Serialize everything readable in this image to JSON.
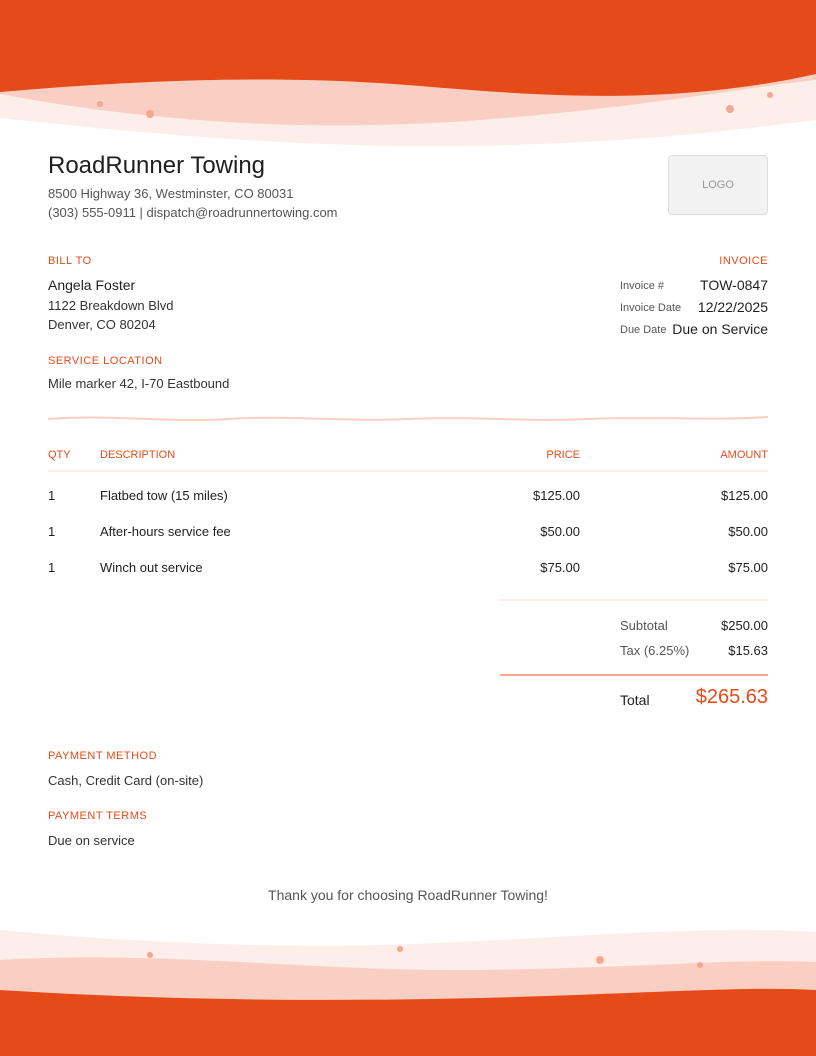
{
  "colors": {
    "accent": "#e64a19",
    "wave_light": "#f8cfc2",
    "wave_pale": "#fdeeea"
  },
  "company": {
    "name": "RoadRunner Towing",
    "address": "8500 Highway 36, Westminster, CO 80031",
    "contact": "(303) 555-0911 | dispatch@roadrunnertowing.com",
    "logo_text": "LOGO"
  },
  "bill_to": {
    "label": "BILL TO",
    "name": "Angela Foster",
    "street": "1122 Breakdown Blvd",
    "city": "Denver, CO 80204"
  },
  "service_location": {
    "label": "SERVICE LOCATION",
    "value": "Mile marker 42, I-70 Eastbound"
  },
  "invoice": {
    "label": "INVOICE",
    "number_label": "Invoice #",
    "number": "TOW-0847",
    "date_label": "Invoice Date",
    "date": "12/22/2025",
    "due_label": "Due Date",
    "due": "Due on Service"
  },
  "table": {
    "headers": {
      "qty": "QTY",
      "description": "DESCRIPTION",
      "price": "PRICE",
      "amount": "AMOUNT"
    },
    "rows": [
      {
        "qty": "1",
        "description": "Flatbed tow (15 miles)",
        "price": "$125.00",
        "amount": "$125.00"
      },
      {
        "qty": "1",
        "description": "After-hours service fee",
        "price": "$50.00",
        "amount": "$50.00"
      },
      {
        "qty": "1",
        "description": "Winch out service",
        "price": "$75.00",
        "amount": "$75.00"
      }
    ]
  },
  "totals": {
    "subtotal_label": "Subtotal",
    "subtotal": "$250.00",
    "tax_label": "Tax (6.25%)",
    "tax": "$15.63",
    "total_label": "Total",
    "total": "$265.63"
  },
  "payment": {
    "method_label": "PAYMENT METHOD",
    "method": "Cash, Credit Card (on-site)",
    "terms_label": "PAYMENT TERMS",
    "terms": "Due on service"
  },
  "footer": {
    "thanks": "Thank you for choosing RoadRunner Towing!"
  }
}
